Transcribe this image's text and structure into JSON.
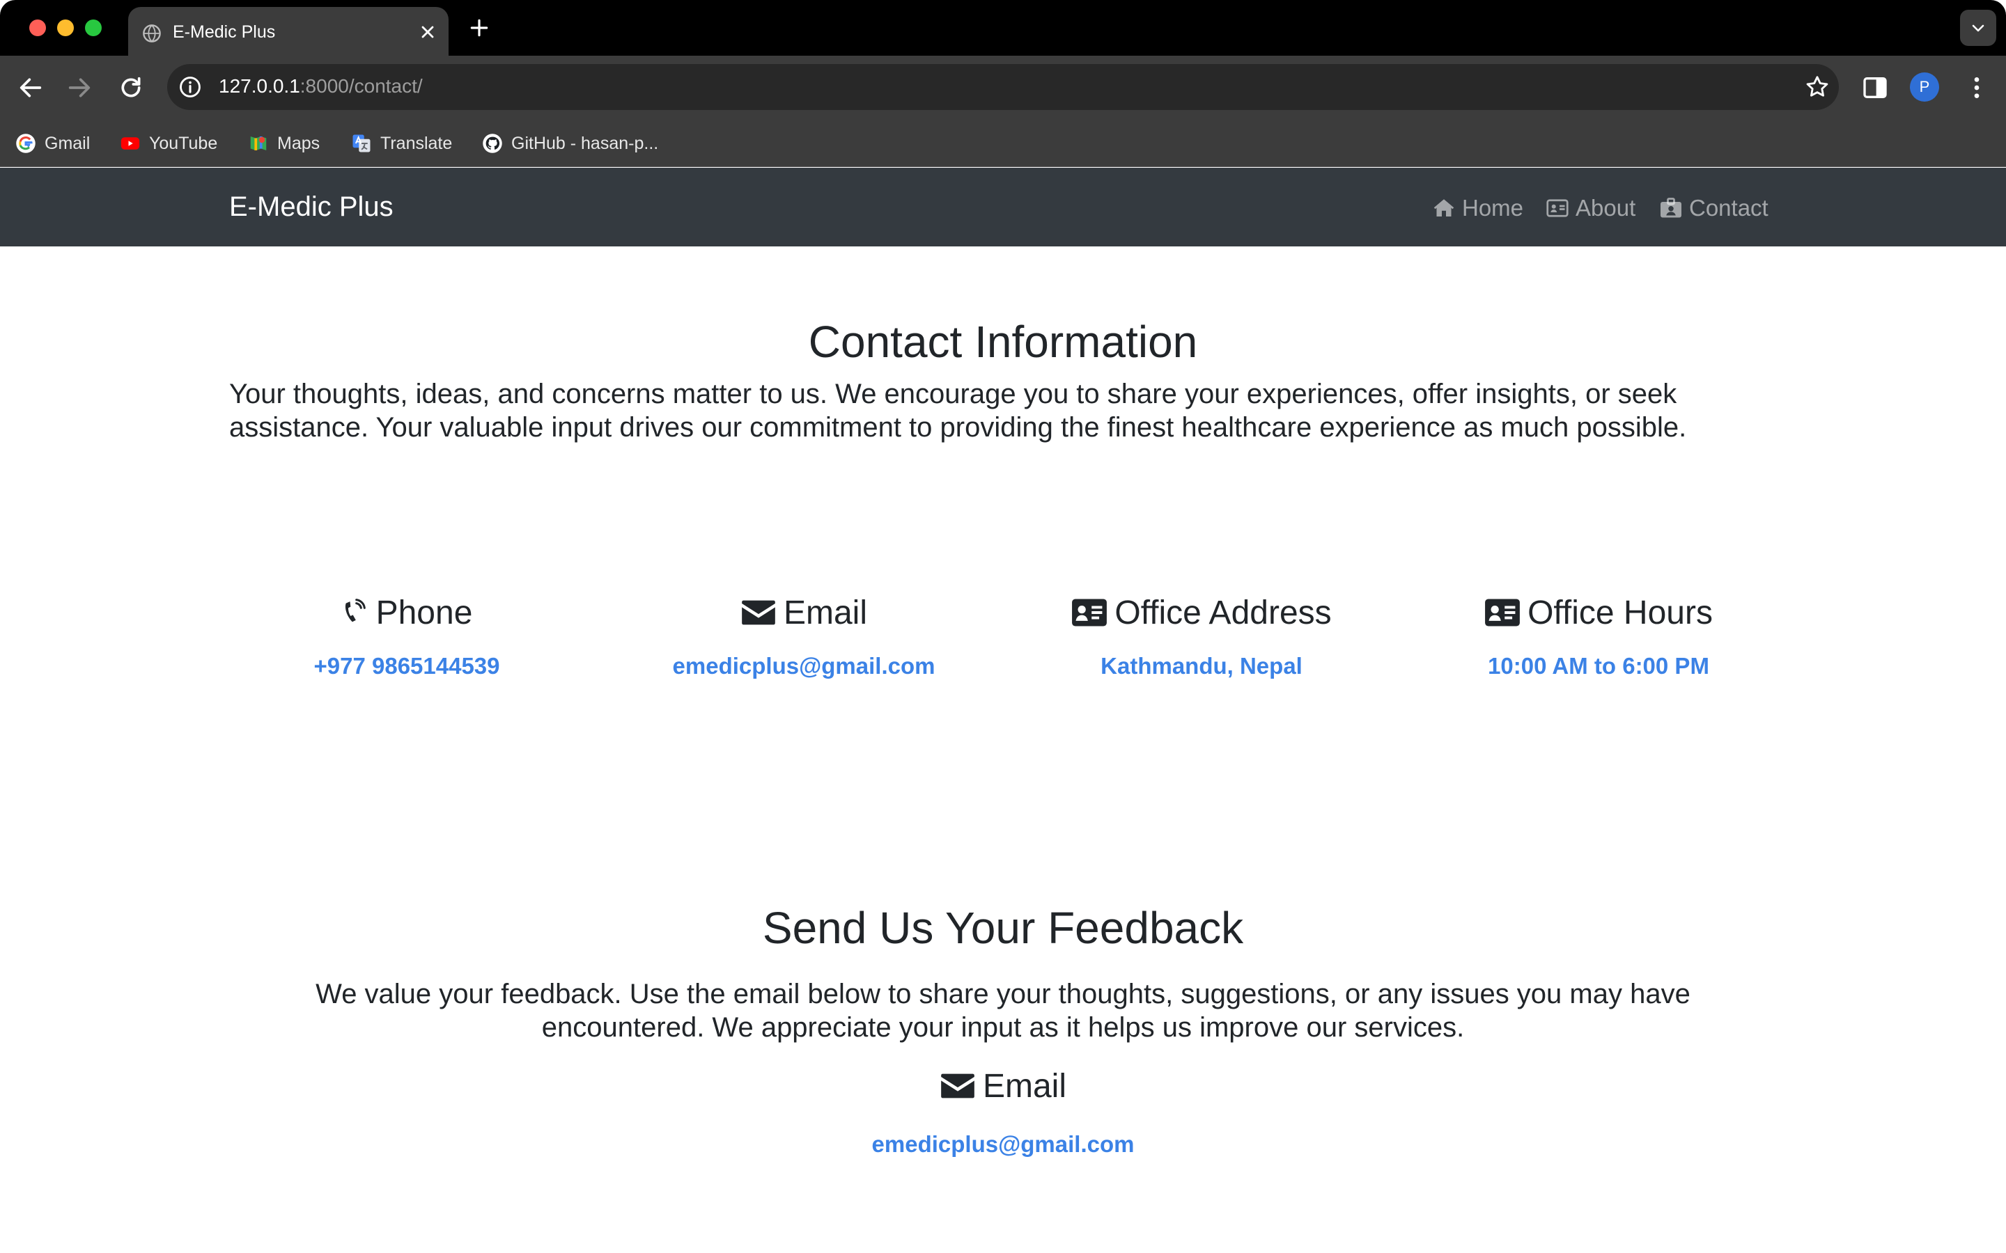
{
  "browser": {
    "tab_title": "E-Medic Plus",
    "url_host": "127.0.0.1",
    "url_rest": ":8000/contact/",
    "profile_initial": "P",
    "bookmarks": [
      {
        "label": "Gmail",
        "icon": "google-icon"
      },
      {
        "label": "YouTube",
        "icon": "youtube-icon"
      },
      {
        "label": "Maps",
        "icon": "maps-icon"
      },
      {
        "label": "Translate",
        "icon": "translate-icon"
      },
      {
        "label": "GitHub - hasan-p...",
        "icon": "github-icon"
      }
    ]
  },
  "site": {
    "brand": "E-Medic Plus",
    "nav": {
      "home": "Home",
      "about": "About",
      "contact": "Contact"
    }
  },
  "contact": {
    "title": "Contact Information",
    "intro": "Your thoughts, ideas, and concerns matter to us. We encourage you to share your experiences, offer insights, or seek assistance. Your valuable input drives our commitment to providing the finest healthcare experience as much possible.",
    "cards": [
      {
        "label": "Phone",
        "value": "+977 9865144539",
        "icon": "phone-icon"
      },
      {
        "label": "Email",
        "value": "emedicplus@gmail.com",
        "icon": "envelope-icon"
      },
      {
        "label": "Office Address",
        "value": "Kathmandu, Nepal",
        "icon": "id-card-icon"
      },
      {
        "label": "Office Hours",
        "value": "10:00 AM to 6:00 PM",
        "icon": "id-card-icon"
      }
    ]
  },
  "feedback": {
    "title": "Send Us Your Feedback",
    "intro": "We value your feedback. Use the email below to share your thoughts, suggestions, or any issues you may have encountered. We appreciate your input as it helps us improve our services.",
    "email_label": "Email",
    "email_value": "emedicplus@gmail.com"
  },
  "colors": {
    "navbar_bg": "#343a40",
    "link_blue": "#3b82e6",
    "text_dark": "#212529"
  }
}
